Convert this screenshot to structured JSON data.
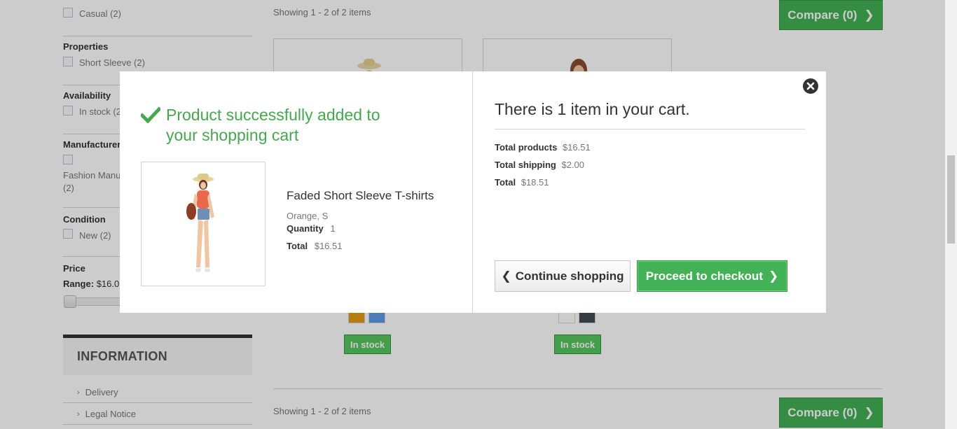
{
  "sidebar": {
    "filters": {
      "casual_label": "Casual (2)",
      "properties_title": "Properties",
      "short_sleeve_label": "Short Sleeve (2)",
      "availability_title": "Availability",
      "in_stock_label": "In stock (2",
      "manufacturer_title": "Manufacturer",
      "manufacturer_label_line1": "Fashion Manu",
      "manufacturer_label_line2": "(2)",
      "condition_title": "Condition",
      "new_label": "New (2)",
      "price_title": "Price",
      "range_label": "Range:",
      "range_value": "$16.0"
    },
    "information": {
      "title": "INFORMATION",
      "items": [
        "Delivery",
        "Legal Notice"
      ]
    }
  },
  "listing": {
    "showing_top": "Showing 1 - 2 of 2 items",
    "showing_bottom": "Showing 1 - 2 of 2 items",
    "compare_label": "Compare (0)",
    "stock_label": "In stock",
    "swatches_product1": [
      "#e59b15",
      "#5d9cec"
    ],
    "swatches_product2": [
      "#ffffff",
      "#434a54"
    ]
  },
  "modal": {
    "success_title": "Product successfully added to your shopping cart",
    "product_name": "Faded Short Sleeve T-shirts",
    "product_attributes": "Orange, S",
    "quantity_label": "Quantity",
    "quantity_value": "1",
    "total_label": "Total",
    "total_value": "$16.51",
    "cart_title": "There is 1 item in your cart.",
    "total_products_label": "Total products",
    "total_products_value": "$16.51",
    "total_shipping_label": "Total shipping",
    "total_shipping_value": "$2.00",
    "cart_total_label": "Total",
    "cart_total_value": "$18.51",
    "continue_label": "Continue shopping",
    "checkout_label": "Proceed to checkout"
  },
  "colors": {
    "success_green": "#46a74e",
    "button_green": "#43b155",
    "overlay": "rgba(0,0,0,0.2)"
  },
  "icons": [
    "check-icon",
    "close-icon",
    "chevron-left-icon",
    "chevron-right-icon"
  ]
}
